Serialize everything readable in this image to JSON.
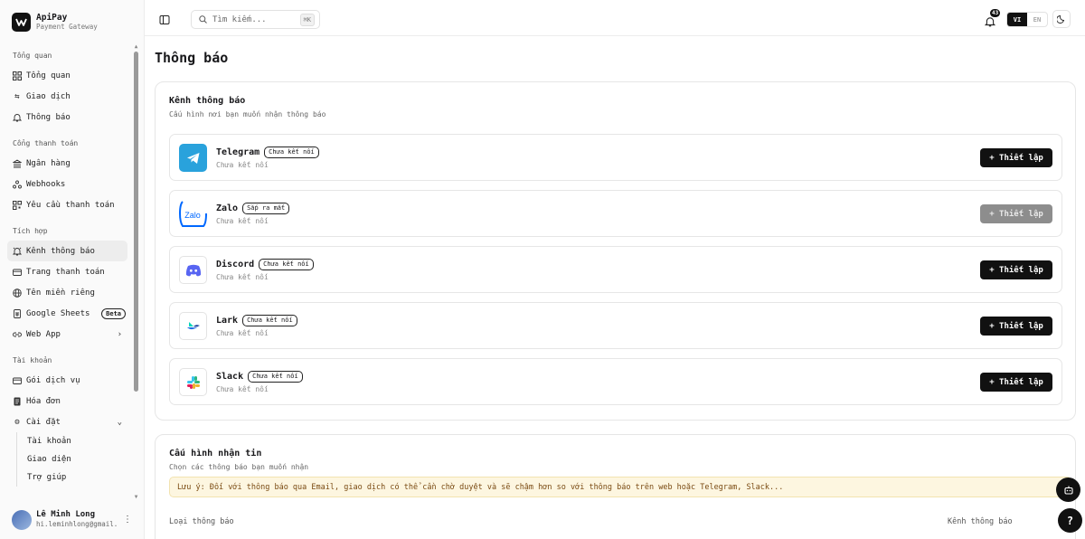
{
  "brand": {
    "name": "ApiPay",
    "subtitle": "Payment Gateway"
  },
  "sidebar": {
    "groups": [
      {
        "title": "Tổng quan",
        "items": [
          {
            "label": "Tổng quan",
            "icon": "grid-icon"
          },
          {
            "label": "Giao dịch",
            "icon": "transfer-icon"
          },
          {
            "label": "Thông báo",
            "icon": "bell-icon"
          }
        ]
      },
      {
        "title": "Cổng thanh toán",
        "items": [
          {
            "label": "Ngân hàng",
            "icon": "bank-icon"
          },
          {
            "label": "Webhooks",
            "icon": "webhook-icon"
          },
          {
            "label": "Yêu cầu thanh toán",
            "icon": "qr-icon"
          }
        ]
      },
      {
        "title": "Tích hợp",
        "items": [
          {
            "label": "Kênh thông báo",
            "icon": "bell-ring-icon",
            "active": true
          },
          {
            "label": "Trang thanh toán",
            "icon": "card-icon"
          },
          {
            "label": "Tên miền riêng",
            "icon": "globe-icon"
          },
          {
            "label": "Google Sheets",
            "icon": "sheet-icon",
            "badge": "Beta"
          },
          {
            "label": "Web App",
            "icon": "link-icon",
            "chevron": "›"
          }
        ]
      },
      {
        "title": "Tài khoản",
        "items": [
          {
            "label": "Gói dịch vụ",
            "icon": "card-icon"
          },
          {
            "label": "Hóa đơn",
            "icon": "invoice-icon"
          },
          {
            "label": "Cài đặt",
            "icon": "gear-icon",
            "chevron": "⌄"
          }
        ]
      }
    ],
    "settings_sub": [
      "Tài khoản",
      "Giao diện",
      "Trợ giúp"
    ],
    "user": {
      "name": "Lê Minh Long",
      "email": "hi.leminhlong@gmail.com"
    }
  },
  "topbar": {
    "search_placeholder": "Tìm kiếm...",
    "search_kbd": "⌘K",
    "notif_count": "43",
    "lang_vi": "VI",
    "lang_en": "EN"
  },
  "page": {
    "title": "Thông báo"
  },
  "channels_card": {
    "title": "Kênh thông báo",
    "subtitle": "Cấu hình nơi bạn muốn nhận thông báo",
    "channels": [
      {
        "name": "Telegram",
        "badge": "Chưa kết nối",
        "status": "Chưa kết nối",
        "button": "+ Thiết lập",
        "disabled": false,
        "color": "#29a2dc"
      },
      {
        "name": "Zalo",
        "badge": "Sắp ra mắt",
        "status": "Chưa kết nối",
        "button": "+ Thiết lập",
        "disabled": true,
        "color": "#0068ff"
      },
      {
        "name": "Discord",
        "badge": "Chưa kết nối",
        "status": "Chưa kết nối",
        "button": "+ Thiết lập",
        "disabled": false,
        "color": "#5865f2"
      },
      {
        "name": "Lark",
        "badge": "Chưa kết nối",
        "status": "Chưa kết nối",
        "button": "+ Thiết lập",
        "disabled": false,
        "color": "#1f6fe5"
      },
      {
        "name": "Slack",
        "badge": "Chưa kết nối",
        "status": "Chưa kết nối",
        "button": "+ Thiết lập",
        "disabled": false,
        "color": "#e01e5a"
      }
    ]
  },
  "receive_card": {
    "title": "Cấu hình nhận tin",
    "subtitle": "Chọn các thông báo bạn muốn nhận",
    "notice": "Lưu ý: Đối với thông báo qua Email, giao dịch có thể cần chờ duyệt và sẽ chậm hơn so với thông báo trên web hoặc Telegram, Slack...",
    "col_type": "Loại thông báo",
    "col_channel": "Kênh thông báo"
  },
  "floating": {
    "help": "?"
  }
}
